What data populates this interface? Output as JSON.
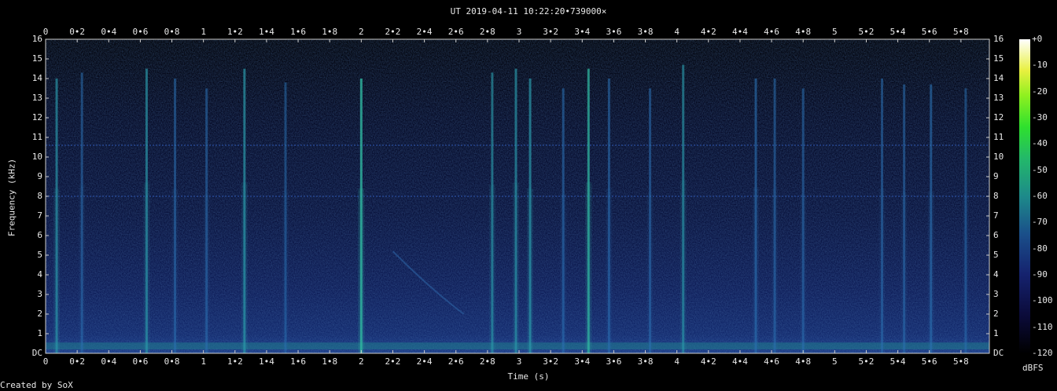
{
  "chart_data": {
    "type": "heatmap",
    "title": "UT 2019-04-11 10:22:20•739000×",
    "xlabel": "Time (s)",
    "ylabel": "Frequency (kHz)",
    "xlim": [
      0,
      5.98
    ],
    "ylim": [
      0,
      16
    ],
    "x_ticks": [
      "0",
      "0•2",
      "0•4",
      "0•6",
      "0•8",
      "1",
      "1•2",
      "1•4",
      "1•6",
      "1•8",
      "2",
      "2•2",
      "2•4",
      "2•6",
      "2•8",
      "3",
      "3•2",
      "3•4",
      "3•6",
      "3•8",
      "4",
      "4•2",
      "4•4",
      "4•6",
      "4•8",
      "5",
      "5•2",
      "5•4",
      "5•6",
      "5•8"
    ],
    "y_ticks": [
      "DC",
      "1",
      "2",
      "3",
      "4",
      "5",
      "6",
      "7",
      "8",
      "9",
      "10",
      "11",
      "12",
      "13",
      "14",
      "15",
      "16"
    ],
    "colorbar": {
      "label": "dBFS",
      "ticks": [
        "+0",
        "-10",
        "-20",
        "-30",
        "-40",
        "-50",
        "-60",
        "-70",
        "-80",
        "-90",
        "-100",
        "-110",
        "-120"
      ],
      "range": [
        -120,
        0
      ]
    },
    "events": [
      {
        "t": 0.07,
        "f_top": 14.0,
        "level": 0.55
      },
      {
        "t": 0.23,
        "f_top": 14.3,
        "level": 0.35
      },
      {
        "t": 0.64,
        "f_top": 14.5,
        "level": 0.55
      },
      {
        "t": 0.82,
        "f_top": 14.0,
        "level": 0.35
      },
      {
        "t": 1.02,
        "f_top": 13.5,
        "level": 0.35
      },
      {
        "t": 1.26,
        "f_top": 14.5,
        "level": 0.6
      },
      {
        "t": 1.52,
        "f_top": 13.8,
        "level": 0.3
      },
      {
        "t": 2.0,
        "f_top": 14.0,
        "level": 0.75
      },
      {
        "t": 2.83,
        "f_top": 14.3,
        "level": 0.5
      },
      {
        "t": 2.98,
        "f_top": 14.5,
        "level": 0.55
      },
      {
        "t": 3.07,
        "f_top": 14.0,
        "level": 0.6
      },
      {
        "t": 3.28,
        "f_top": 13.5,
        "level": 0.4
      },
      {
        "t": 3.44,
        "f_top": 14.5,
        "level": 0.65
      },
      {
        "t": 3.57,
        "f_top": 14.0,
        "level": 0.4
      },
      {
        "t": 3.83,
        "f_top": 13.5,
        "level": 0.35
      },
      {
        "t": 4.04,
        "f_top": 14.7,
        "level": 0.5
      },
      {
        "t": 4.5,
        "f_top": 14.0,
        "level": 0.45
      },
      {
        "t": 4.62,
        "f_top": 14.0,
        "level": 0.35
      },
      {
        "t": 4.8,
        "f_top": 13.5,
        "level": 0.35
      },
      {
        "t": 5.3,
        "f_top": 14.0,
        "level": 0.35
      },
      {
        "t": 5.44,
        "f_top": 13.7,
        "level": 0.35
      },
      {
        "t": 5.61,
        "f_top": 13.7,
        "level": 0.45
      },
      {
        "t": 5.83,
        "f_top": 13.5,
        "level": 0.3
      }
    ],
    "tones_khz": [
      10.6,
      8.0
    ]
  },
  "footer": {
    "credit": "Created by SoX"
  }
}
